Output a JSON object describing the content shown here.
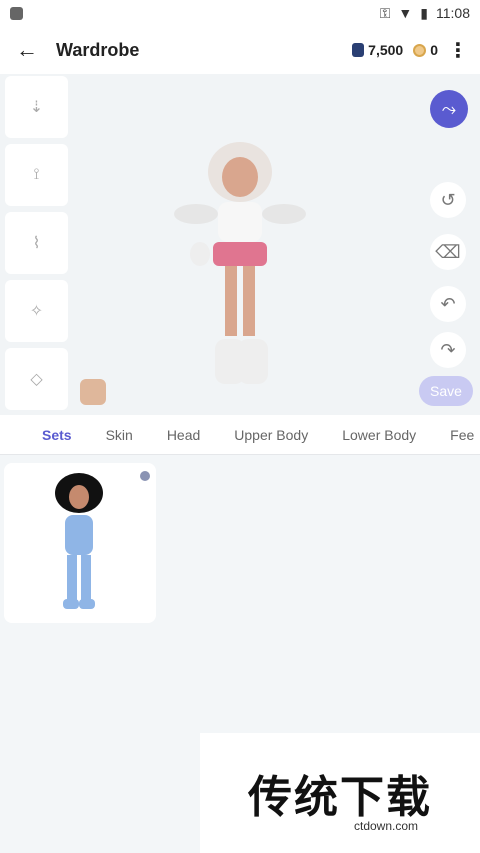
{
  "statusbar": {
    "time": "11:08"
  },
  "appbar": {
    "title": "Wardrobe",
    "gems": "7,500",
    "coins": "0"
  },
  "actions": {
    "save": "Save"
  },
  "tabs": [
    "Sets",
    "Skin",
    "Head",
    "Upper Body",
    "Lower Body",
    "Fee"
  ],
  "watermark": {
    "text": "传统下载",
    "sub": "ctdown.com"
  }
}
